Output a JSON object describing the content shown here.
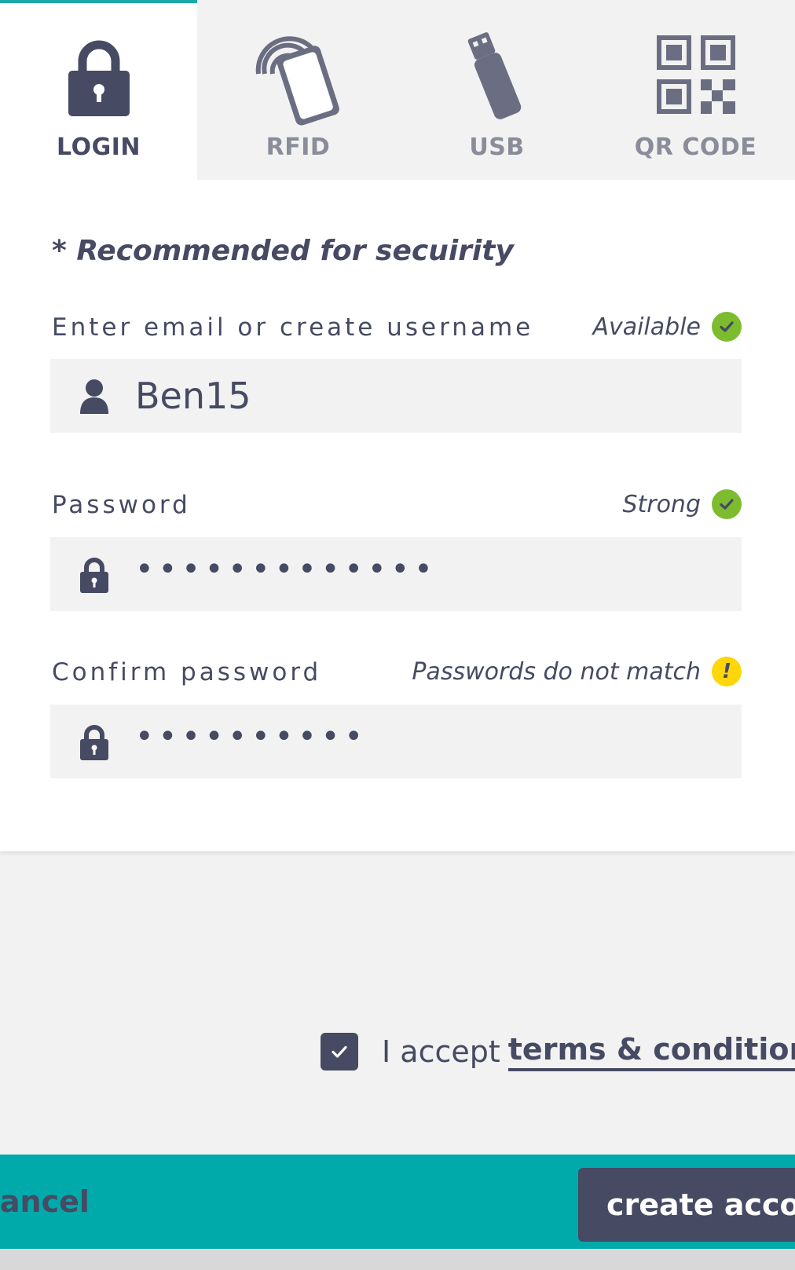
{
  "tabs": [
    {
      "label": "LOGIN",
      "icon": "lock-icon",
      "active": true
    },
    {
      "label": "RFID",
      "icon": "rfid-card-icon",
      "active": false
    },
    {
      "label": "USB",
      "icon": "usb-drive-icon",
      "active": false
    },
    {
      "label": "QR CODE",
      "icon": "qr-code-icon",
      "active": false
    }
  ],
  "form": {
    "recommendation": "* Recommended for secuirity",
    "username": {
      "label": "Enter email or create username",
      "status": "Available",
      "value": "Ben15"
    },
    "password": {
      "label": "Password",
      "status": "Strong",
      "value": "•••••••••••••"
    },
    "confirm": {
      "label": "Confirm password",
      "status": "Passwords do not match",
      "status_mark": "!",
      "value": "••••••••••"
    }
  },
  "terms": {
    "prefix": "I accept",
    "link": "terms & conditions",
    "checked": true
  },
  "actions": {
    "cancel": "Cancel",
    "create": "create account"
  },
  "colors": {
    "primary": "#464a63",
    "accent": "#00aaaa",
    "tab_indicator": "#1aa8a8",
    "ok": "#7dbb2f",
    "warn": "#ffd60a",
    "field_bg": "#f2f2f2"
  }
}
